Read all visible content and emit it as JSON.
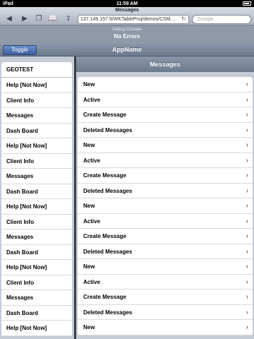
{
  "status_bar": {
    "device": "iPad",
    "time": "11:59 AM"
  },
  "browser": {
    "page_title": "Messages",
    "url": "137.149.157.9/WKTableProj/demos/CSM…",
    "search_placeholder": "Google"
  },
  "debug": {
    "title": "Debug Console",
    "status": "No Errors"
  },
  "app": {
    "title": "AppName",
    "toggle_label": "Toggle"
  },
  "master": {
    "header": "GEOTEST",
    "items": [
      "Help [Not Now]",
      "Client Info",
      "Messages",
      "Dash Board",
      "Help [Not Now]",
      "Client Info",
      "Messages",
      "Dash Board",
      "Help [Not Now]",
      "Client Info",
      "Messages",
      "Dash Board",
      "Help [Not Now]",
      "Client Info",
      "Messages",
      "Dash Board",
      "Help [Not Now]"
    ]
  },
  "detail": {
    "title": "Messages",
    "items": [
      "New",
      "Active",
      "Create Message",
      "Deleted Messages",
      "New",
      "Active",
      "Create Message",
      "Deleted Messages",
      "New",
      "Active",
      "Create Message",
      "Deleted Messages",
      "New",
      "Active",
      "Create Message",
      "Deleted Messages",
      "New"
    ]
  }
}
